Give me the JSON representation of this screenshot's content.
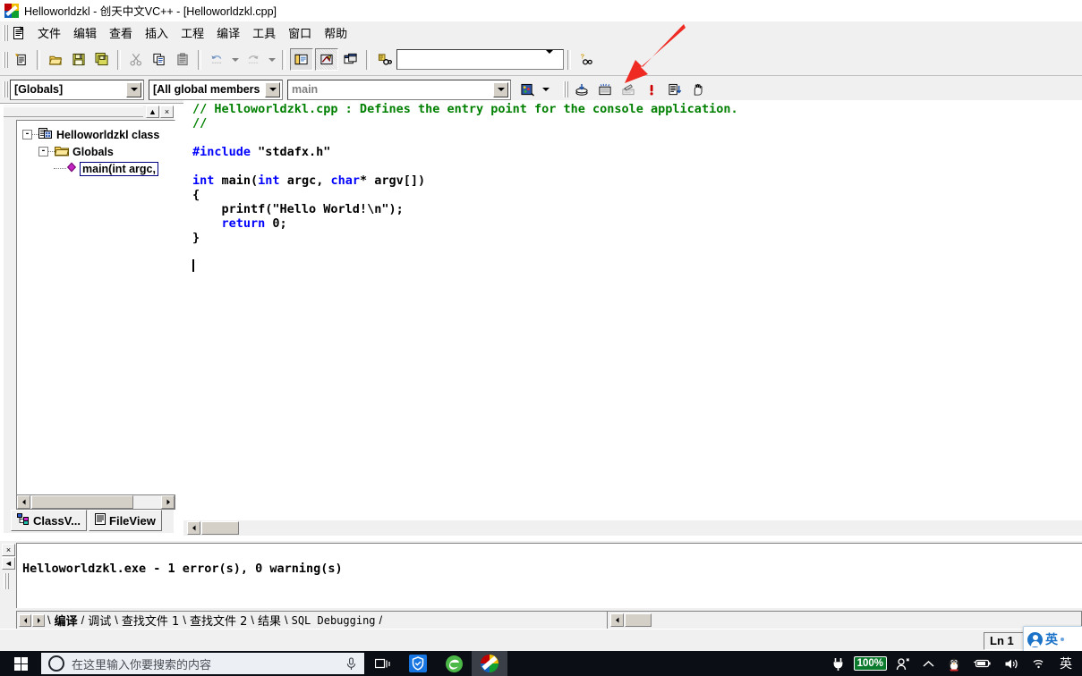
{
  "window": {
    "title": "Helloworldzkl - 创天中文VC++ - [Helloworldzkl.cpp]",
    "app_icon": "vc-swirl-icon"
  },
  "menubar": {
    "doc_icon": "document-icon",
    "items": [
      {
        "label": "文件"
      },
      {
        "label": "编辑"
      },
      {
        "label": "查看"
      },
      {
        "label": "插入"
      },
      {
        "label": "工程"
      },
      {
        "label": "编译"
      },
      {
        "label": "工具"
      },
      {
        "label": "窗口"
      },
      {
        "label": "帮助"
      }
    ]
  },
  "toolbar_standard": {
    "buttons": [
      {
        "name": "new-document-icon",
        "label": "新建"
      },
      {
        "name": "open-folder-icon",
        "label": "打开"
      },
      {
        "name": "save-icon",
        "label": "保存"
      },
      {
        "name": "save-all-icon",
        "label": "全部保存"
      },
      {
        "name": "cut-icon",
        "label": "剪切"
      },
      {
        "name": "copy-icon",
        "label": "复制"
      },
      {
        "name": "paste-icon",
        "label": "粘贴"
      },
      {
        "name": "undo-icon",
        "label": "撤消"
      },
      {
        "name": "redo-icon",
        "label": "恢复"
      },
      {
        "name": "workspace-icon",
        "label": "工作区"
      },
      {
        "name": "output-window-icon",
        "label": "输出窗口"
      },
      {
        "name": "window-list-icon",
        "label": "窗口列表"
      },
      {
        "name": "find-in-files-icon",
        "label": "在文件中查找"
      }
    ],
    "find_box": {
      "value": "",
      "placeholder": ""
    },
    "help_button": {
      "name": "help-find-icon",
      "label": "帮助查找"
    }
  },
  "toolbar_wizard": {
    "class_combo": {
      "value": "[Globals]",
      "name": "class-selector"
    },
    "members_combo": {
      "value": "[All global members",
      "name": "members-selector"
    },
    "function_combo": {
      "value": "main",
      "name": "function-selector"
    },
    "wizardbar_icon": "wizardbar-icon"
  },
  "toolbar_build": {
    "buttons": [
      {
        "name": "compile-icon",
        "label": "编译"
      },
      {
        "name": "build-icon",
        "label": "构建"
      },
      {
        "name": "stop-build-icon",
        "label": "停止构建"
      },
      {
        "name": "execute-program-icon",
        "label": "执行程序"
      },
      {
        "name": "go-debug-icon",
        "label": "开始调试"
      },
      {
        "name": "insert-breakpoint-icon",
        "label": "插入断点"
      }
    ]
  },
  "annotation": {
    "arrow_color": "#ee2a22",
    "points_at": "execute-program-icon"
  },
  "workspace": {
    "close_button": "×",
    "minimize_button": "▲",
    "tree": [
      {
        "label": "Helloworldzkl class",
        "icon": "class-project-icon",
        "expander": "-",
        "depth": 0,
        "selected": false
      },
      {
        "label": "Globals",
        "icon": "folder-icon",
        "expander": "-",
        "depth": 1,
        "selected": false
      },
      {
        "label": "main(int argc,",
        "icon": "member-diamond-icon",
        "expander": "",
        "depth": 2,
        "selected": true
      }
    ],
    "tabs": [
      {
        "label": "ClassV...",
        "icon": "classview-icon",
        "active": true
      },
      {
        "label": "FileView",
        "icon": "fileview-icon",
        "active": false
      }
    ]
  },
  "editor": {
    "filename": "Helloworldzkl.cpp",
    "lines": [
      {
        "segments": [
          {
            "t": "// Helloworldzkl.cpp : Defines the entry point for the console application.",
            "c": "c-com"
          }
        ]
      },
      {
        "segments": [
          {
            "t": "//",
            "c": "c-com"
          }
        ]
      },
      {
        "segments": [
          {
            "t": "",
            "c": "c-txt"
          }
        ]
      },
      {
        "segments": [
          {
            "t": "#include",
            "c": "c-key"
          },
          {
            "t": " \"stdafx.h\"",
            "c": "c-txt"
          }
        ]
      },
      {
        "segments": [
          {
            "t": "",
            "c": "c-txt"
          }
        ]
      },
      {
        "segments": [
          {
            "t": "int",
            "c": "c-key"
          },
          {
            "t": " main(",
            "c": "c-txt"
          },
          {
            "t": "int",
            "c": "c-key"
          },
          {
            "t": " argc, ",
            "c": "c-txt"
          },
          {
            "t": "char",
            "c": "c-key"
          },
          {
            "t": "* argv[])",
            "c": "c-txt"
          }
        ]
      },
      {
        "segments": [
          {
            "t": "{",
            "c": "c-txt"
          }
        ]
      },
      {
        "segments": [
          {
            "t": "    printf(\"Hello World!\\n\");",
            "c": "c-txt"
          }
        ]
      },
      {
        "segments": [
          {
            "t": "    ",
            "c": "c-txt"
          },
          {
            "t": "return",
            "c": "c-key"
          },
          {
            "t": " 0;",
            "c": "c-txt"
          }
        ]
      },
      {
        "segments": [
          {
            "t": "}",
            "c": "c-txt"
          }
        ]
      },
      {
        "segments": [
          {
            "t": "",
            "c": "c-txt"
          }
        ]
      },
      {
        "segments": [
          {
            "t": "",
            "c": "c-txt"
          }
        ]
      }
    ]
  },
  "output": {
    "text": "Helloworldzkl.exe - 1 error(s), 0 warning(s)",
    "close_button": "×",
    "scroll_button": "◄",
    "tabs": [
      {
        "label": "编译",
        "active": true
      },
      {
        "label": "调试",
        "active": false
      },
      {
        "label": "查找文件 1",
        "active": false
      },
      {
        "label": "查找文件 2",
        "active": false
      },
      {
        "label": "结果",
        "active": false
      },
      {
        "label": "SQL Debugging",
        "active": false
      }
    ]
  },
  "statusbar": {
    "line_indicator": "Ln 1"
  },
  "ime_popup": {
    "mode": "英",
    "avatar_icon": "user-avatar-icon"
  },
  "taskbar": {
    "start_button": "windows-start-icon",
    "search": {
      "placeholder": "在这里输入你要搜索的内容",
      "value": ""
    },
    "mic_icon": "microphone-icon",
    "taskview_icon": "task-view-icon",
    "apps": [
      {
        "name": "taskbar-app-security",
        "label": "安全软件",
        "active": false
      },
      {
        "name": "taskbar-app-browser",
        "label": "浏览器",
        "active": false
      },
      {
        "name": "taskbar-app-vcpp",
        "label": "创天中文VC++",
        "active": true
      }
    ],
    "tray": {
      "plug_icon": "power-plug-icon",
      "battery_percent": "100%",
      "people_icon": "people-icon",
      "chevron_icon": "chevron-up-icon",
      "qq_icon": "qq-penguin-icon",
      "battery_icon": "battery-icon",
      "volume_icon": "volume-icon",
      "wifi_icon": "wifi-icon",
      "ime_text": "英"
    }
  },
  "colors": {
    "comment_green": "#008000",
    "keyword_blue": "#0000ff",
    "accent_red": "#ee2a22",
    "chrome_gray": "#f0f0f0",
    "taskbar_dark": "#0b0e14"
  }
}
